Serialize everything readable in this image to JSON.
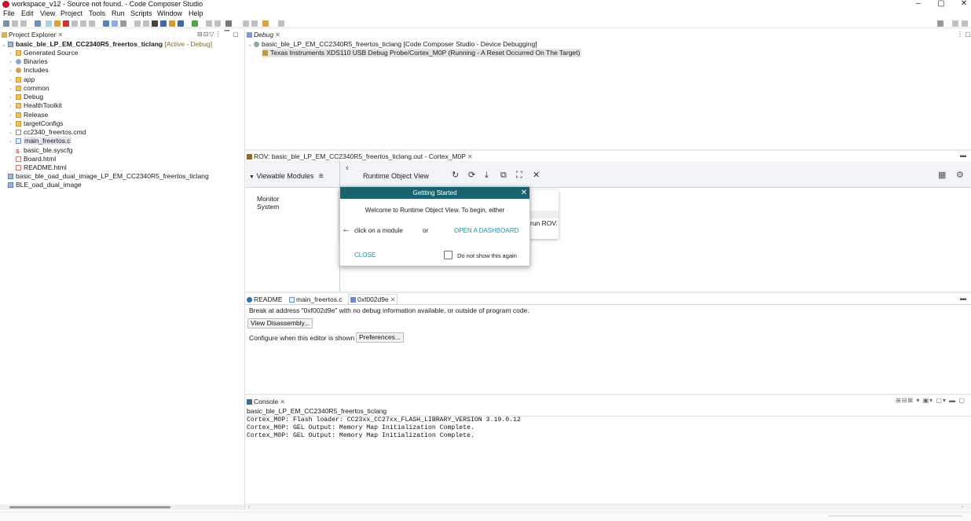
{
  "window": {
    "title": "workspace_v12 - Source not found. - Code Composer Studio",
    "controls": [
      "–",
      "▢",
      "✕"
    ]
  },
  "menu": [
    "File",
    "Edit",
    "View",
    "Project",
    "Tools",
    "Run",
    "Scripts",
    "Window",
    "Help"
  ],
  "project_explorer": {
    "tab_label": "Project Explorer",
    "items": [
      {
        "label": "basic_ble_LP_EM_CC2340R5_freertos_ticlang",
        "suffix": "[Active - Debug]",
        "icon": "project-icon"
      },
      {
        "label": "Generated Source",
        "icon": "folder-icon"
      },
      {
        "label": "Binaries",
        "icon": "binaries-icon"
      },
      {
        "label": "Includes",
        "icon": "includes-icon"
      },
      {
        "label": "app",
        "icon": "folder-icon"
      },
      {
        "label": "common",
        "icon": "folder-icon"
      },
      {
        "label": "Debug",
        "icon": "folder-icon"
      },
      {
        "label": "HealthToolkit",
        "icon": "folder-icon"
      },
      {
        "label": "Release",
        "icon": "folder-icon"
      },
      {
        "label": "targetConfigs",
        "icon": "folder-icon"
      },
      {
        "label": "cc2340_freertos.cmd",
        "icon": "file-icon"
      },
      {
        "label": "main_freertos.c",
        "icon": "c-file-icon"
      },
      {
        "label": "basic_ble.syscfg",
        "icon": "syscfg-icon"
      },
      {
        "label": "Board.html",
        "icon": "html-file-icon"
      },
      {
        "label": "README.html",
        "icon": "html-file-icon"
      },
      {
        "label": "basic_ble_oad_dual_image_LP_EM_CC2340R5_freertos_ticlang",
        "icon": "project-icon"
      },
      {
        "label": "BLE_oad_dual_image",
        "icon": "project-icon"
      }
    ]
  },
  "debug": {
    "tab_label": "Debug",
    "session": "basic_ble_LP_EM_CC2340R5_freertos_ticlang [Code Composer Studio - Device Debugging]",
    "target": "Texas Instruments XDS110 USB Debug Probe/Cortex_M0P (Running - A Reset Occurred On The Target)"
  },
  "rov": {
    "tab_label": "ROV: basic_ble_LP_EM_CC2340R5_freertos_ticlang.out - Cortex_M0P",
    "viewable_modules": "Viewable Modules",
    "title": "Runtime Object View",
    "modules": [
      "Monitor",
      "System"
    ],
    "partial_text": "run ROV."
  },
  "dialog": {
    "title": "Gettting Started",
    "welcome": "Welcome to Runtime Object View. To begin, either",
    "click_module": "click on a module",
    "or": "or",
    "open_dashboard": "OPEN A DASHBOARD",
    "close": "CLOSE",
    "dont_show": "Do not show this again"
  },
  "editor": {
    "tabs": [
      "README",
      "main_freertos.c",
      "0xf002d9e"
    ],
    "message": "Break at address \"0xf002d9e\" with no debug information available, or outside of program code.",
    "view_disassembly": "View Disassembly...",
    "configure_text": "Configure when this editor is shown",
    "preferences": "Preferences..."
  },
  "console": {
    "tab_label": "Console",
    "header": "basic_ble_LP_EM_CC2340R5_freertos_ticlang",
    "lines": [
      "Cortex_M0P: Flash loader: CC23xx_CC27xx_FLASH_LIBRARY_VERSION 3.19.0.12",
      "Cortex_M0P: GEL Output: Memory Map Initialization Complete.",
      "Cortex_M0P: GEL Output: Memory Map Initialization Complete."
    ]
  },
  "colors": {
    "dialog_header": "#176470",
    "accent_teal": "#1a93a8",
    "app_red": "#c8102e"
  }
}
